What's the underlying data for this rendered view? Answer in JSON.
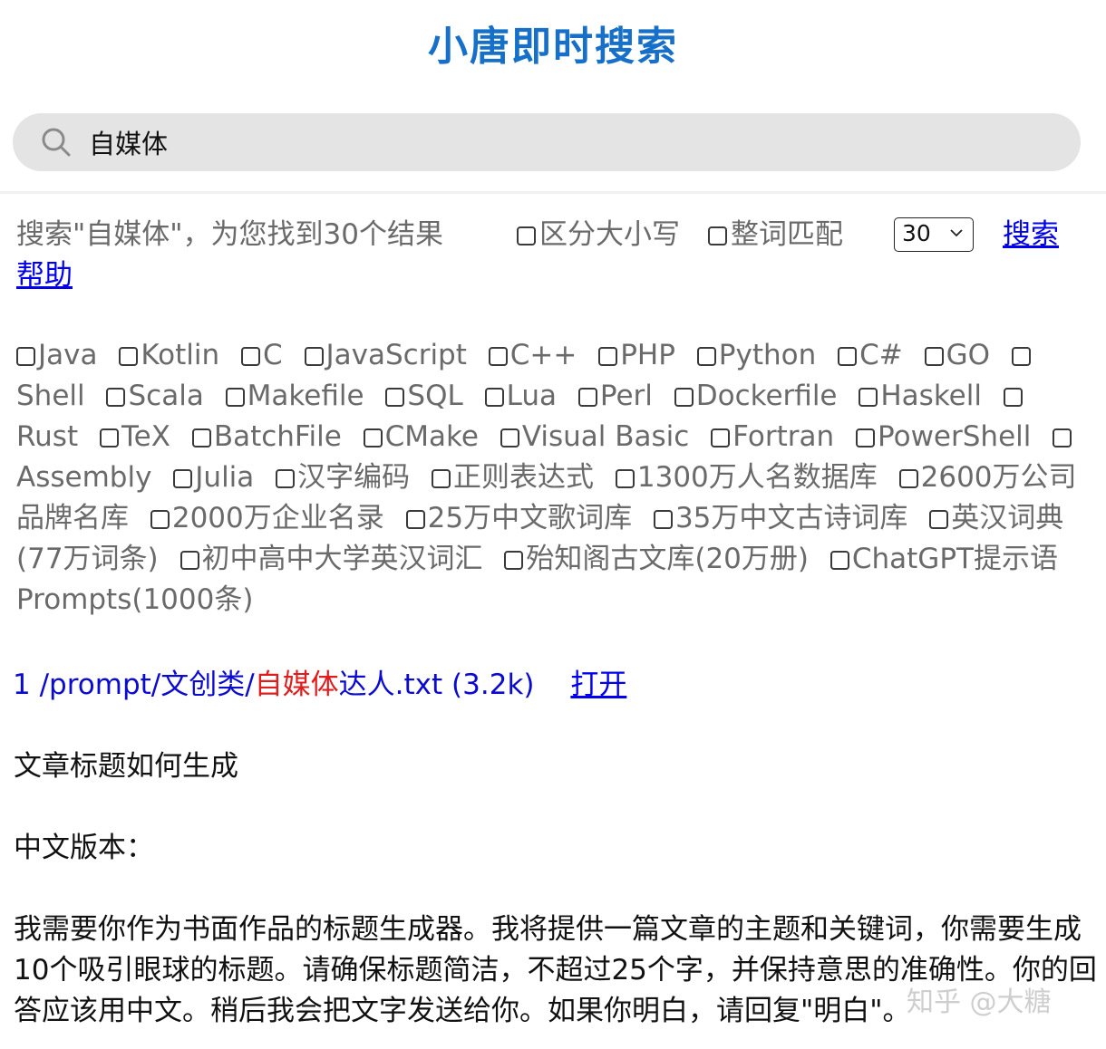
{
  "app_title": "小唐即时搜索",
  "search": {
    "value": "自媒体",
    "placeholder": ""
  },
  "options": {
    "result_summary": "搜索\"自媒体\"，为您找到30个结果",
    "case_sensitive_label": "区分大小写",
    "whole_word_label": "整词匹配",
    "count_selected": "30",
    "search_link": "搜索",
    "help_link": "帮助"
  },
  "languages": [
    "Java",
    "Kotlin",
    "C",
    "JavaScript",
    "C++",
    "PHP",
    "Python",
    "C#",
    "GO",
    "Shell",
    "Scala",
    "Makefile",
    "SQL",
    "Lua",
    "Perl",
    "Dockerfile",
    "Haskell",
    "Rust",
    "TeX",
    "BatchFile",
    "CMake",
    "Visual Basic",
    "Fortran",
    "PowerShell",
    "Assembly",
    "Julia",
    "汉字编码",
    "正则表达式",
    "1300万人名数据库",
    "2600万公司品牌名库",
    "2000万企业名录",
    "25万中文歌词库",
    "35万中文古诗词库",
    "英汉词典(77万词条)",
    "初中高中大学英汉词汇",
    "殆知阁古文库(20万册)",
    "ChatGPT提示语Prompts(1000条)"
  ],
  "result": {
    "index": "1",
    "path_prefix": "/prompt/文创类/",
    "path_highlight": "自媒体",
    "path_suffix": "达人.txt",
    "size": "(3.2k)",
    "open_link": "打开"
  },
  "content": {
    "line1": "文章标题如何生成",
    "line2": "中文版本：",
    "paragraph": "我需要你作为书面作品的标题生成器。我将提供一篇文章的主题和关键词，你需要生成10个吸引眼球的标题。请确保标题简洁，不超过25个字，并保持意思的准确性。你的回答应该用中文。稍后我会把文字发送给你。如果你明白，请回复\"明白\"。"
  },
  "watermark": "知乎 @大糖",
  "colors": {
    "title": "#1670c9",
    "search_bg": "#e4e4e4",
    "link": "#0000ee",
    "result_text": "#0a0ad0",
    "highlight": "#e01c1c",
    "muted_text": "#6a6a6a"
  },
  "icons": {
    "search": "search-icon",
    "dropdown": "chevron-down-icon"
  }
}
